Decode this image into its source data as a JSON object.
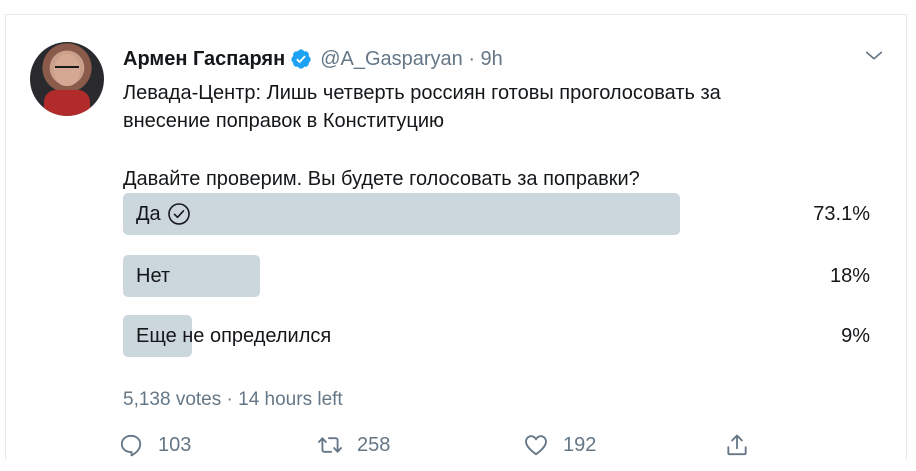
{
  "tweet": {
    "author_name": "Армен Гаспарян",
    "handle_time": "@A_Gasparyan · 9h",
    "text_line1": "Левада-Центр: Лишь четверть россиян готовы проголосовать за",
    "text_line2": "внесение поправок в Конституцию",
    "question": "Давайте проверим. Вы будете голосовать за поправки?"
  },
  "poll": {
    "options": [
      {
        "label": "Да",
        "percent_text": "73.1%",
        "percent": 73.1,
        "selected": true
      },
      {
        "label": "Нет",
        "percent_text": "18%",
        "percent": 18,
        "selected": false
      },
      {
        "label": "Еще не определился",
        "percent_text": "9%",
        "percent": 9,
        "selected": false
      }
    ],
    "meta": "5,138 votes · 14 hours left"
  },
  "actions": {
    "reply_count": "103",
    "retweet_count": "258",
    "like_count": "192"
  },
  "colors": {
    "bar": "#ccd6dd",
    "verified": "#1da1f2",
    "secondary_text": "#657786"
  }
}
